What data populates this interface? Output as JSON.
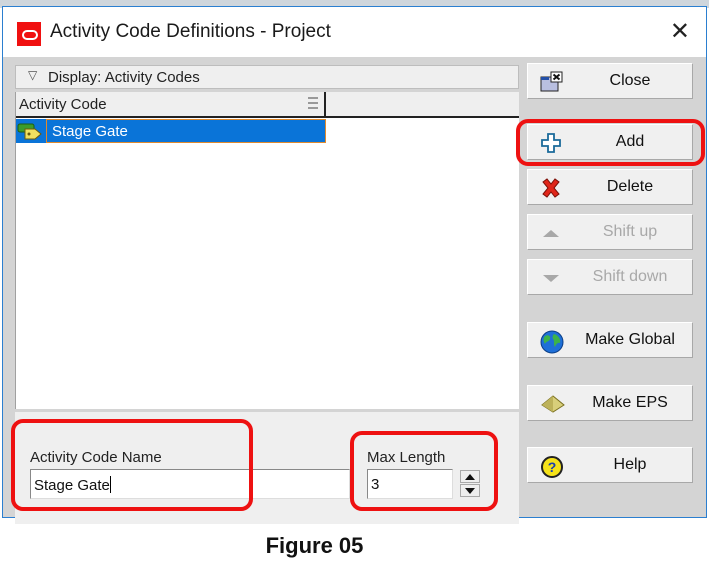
{
  "dialog": {
    "title": "Activity Code Definitions - Project",
    "close_glyph": "✕"
  },
  "display_bar": {
    "label": "Display: Activity Codes",
    "chevron_glyph": "▽"
  },
  "grid": {
    "columns": [
      {
        "label": "Activity Code"
      }
    ],
    "rows": [
      {
        "name": "Stage Gate",
        "selected": true,
        "icon": "tag-icon"
      }
    ]
  },
  "form": {
    "activity_code_name_label": "Activity Code Name",
    "activity_code_name_value": "Stage Gate",
    "max_length_label": "Max Length",
    "max_length_value": "3"
  },
  "buttons": {
    "close": {
      "label": "Close",
      "icon": "window-close-icon",
      "enabled": true
    },
    "add": {
      "label": "Add",
      "icon": "plus-icon",
      "enabled": true,
      "highlighted": true
    },
    "delete": {
      "label": "Delete",
      "icon": "red-x-icon",
      "enabled": true
    },
    "shift_up": {
      "label": "Shift up",
      "icon": "triangle-up-icon",
      "enabled": false
    },
    "shift_down": {
      "label": "Shift down",
      "icon": "triangle-down-icon",
      "enabled": false
    },
    "make_global": {
      "label": "Make Global",
      "icon": "globe-icon",
      "enabled": true
    },
    "make_eps": {
      "label": "Make EPS",
      "icon": "pyramid-icon",
      "enabled": true
    },
    "help": {
      "label": "Help",
      "icon": "help-icon",
      "enabled": true
    }
  },
  "colors": {
    "highlight": "#ee1111",
    "selection": "#0a74d8",
    "app_icon": "#f01010"
  },
  "caption": "Figure 05"
}
